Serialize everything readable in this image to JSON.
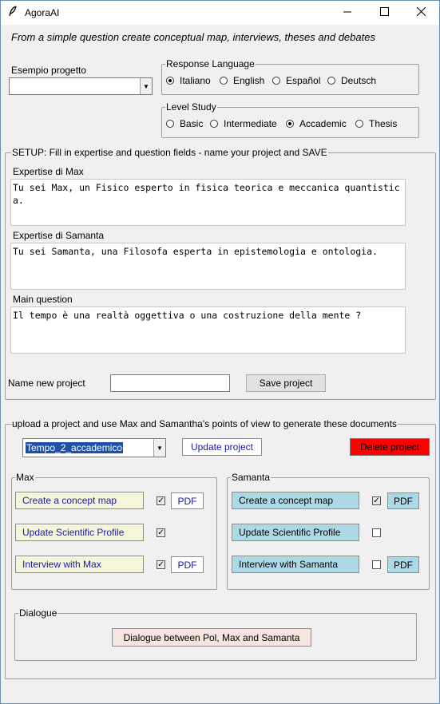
{
  "window": {
    "title": "AgoraAI",
    "app_icon": "feather-icon"
  },
  "subtitle": "From a simple question create conceptual map, interviews, theses and debates",
  "example_project": {
    "label": "Esempio progetto",
    "value": ""
  },
  "language": {
    "legend": "Response Language",
    "options": [
      "Italiano",
      "English",
      "Español",
      "Deutsch"
    ],
    "selected": "Italiano"
  },
  "level": {
    "legend": "Level Study",
    "options": [
      "Basic",
      "Intermediate",
      "Accademic",
      "Thesis"
    ],
    "selected": "Accademic"
  },
  "setup": {
    "legend": "SETUP: Fill in expertise and question fields - name your project and SAVE",
    "max_label": "Expertise di Max",
    "max_text": "Tu sei Max, un Fisico esperto in fisica teorica e meccanica quantistica.",
    "samanta_label": "Expertise di Samanta",
    "samanta_text": "Tu sei Samanta, una Filosofa esperta in epistemologia e ontologia.",
    "question_label": "Main question",
    "question_text": "Il tempo è una realtà oggettiva o una costruzione della mente ?",
    "name_label": "Name new project",
    "name_value": "",
    "save_label": "Save project"
  },
  "upload": {
    "legend": "upload a project and use Max and Samantha's points of view to generate these documents",
    "project_value": "Tempo_2_accademico",
    "update_label": "Update project",
    "delete_label": "Delete project"
  },
  "max_panel": {
    "legend": "Max",
    "concept_map": "Create a concept map",
    "concept_checked": true,
    "profile": "Update Scientific Profile",
    "profile_checked": true,
    "interview": "Interview with Max",
    "interview_checked": true,
    "pdf": "PDF"
  },
  "samanta_panel": {
    "legend": "Samanta",
    "concept_map": "Create a concept map",
    "concept_checked": true,
    "profile": "Update Scientific Profile",
    "profile_checked": false,
    "interview": "Interview with Samanta",
    "interview_checked": false,
    "pdf": "PDF"
  },
  "dialogue": {
    "legend": "Dialogue",
    "button": "Dialogue between Pol, Max and Samanta"
  },
  "colors": {
    "max_button_bg": "#f5f5dc",
    "samanta_button_bg": "#add8e6",
    "delete_bg": "#ff0000",
    "dialogue_bg": "#f5e4e0",
    "link_text": "#1a1aa6"
  }
}
